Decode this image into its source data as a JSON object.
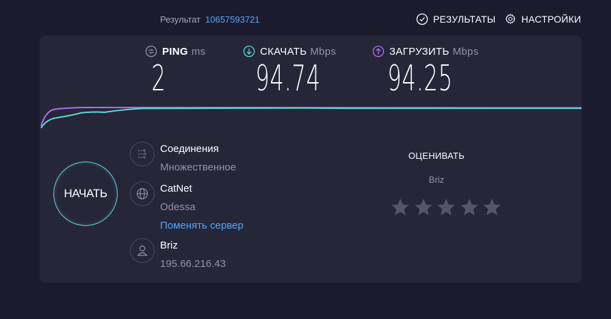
{
  "header": {
    "result_label": "Результат",
    "result_id": "10657593721",
    "results_link": "РЕЗУЛЬТАТЫ",
    "settings_link": "НАСТРОЙКИ"
  },
  "metrics": {
    "ping": {
      "name": "PING",
      "unit": "ms",
      "value": "2"
    },
    "download": {
      "name": "СКАЧАТЬ",
      "unit": "Mbps",
      "value": "94.74"
    },
    "upload": {
      "name": "ЗАГРУЗИТЬ",
      "unit": "Mbps",
      "value": "94.25"
    }
  },
  "start_button": "НАЧАТЬ",
  "connections": {
    "title": "Соединения",
    "value": "Множественное"
  },
  "server": {
    "name": "CatNet",
    "location": "Odessa",
    "change_link": "Поменять сервер"
  },
  "provider": {
    "name": "Briz",
    "ip": "195.66.216.43"
  },
  "rating": {
    "title": "ОЦЕНИВАТЬ",
    "isp": "Briz",
    "stars_total": 5,
    "stars_selected": 0
  },
  "colors": {
    "background": "#1c1b2e",
    "panel": "#262639",
    "accent_cyan": "#5fd8d8",
    "accent_purple": "#b06ef0",
    "link_blue": "#4fa8ff",
    "muted": "#9193a8"
  },
  "icons": {
    "results": "check-circle-icon",
    "settings": "gear-icon",
    "ping": "ping-icon",
    "download": "download-arrow-icon",
    "upload": "upload-arrow-icon",
    "connections": "connections-arrows-icon",
    "server": "globe-icon",
    "provider": "user-icon",
    "star": "star-icon"
  }
}
